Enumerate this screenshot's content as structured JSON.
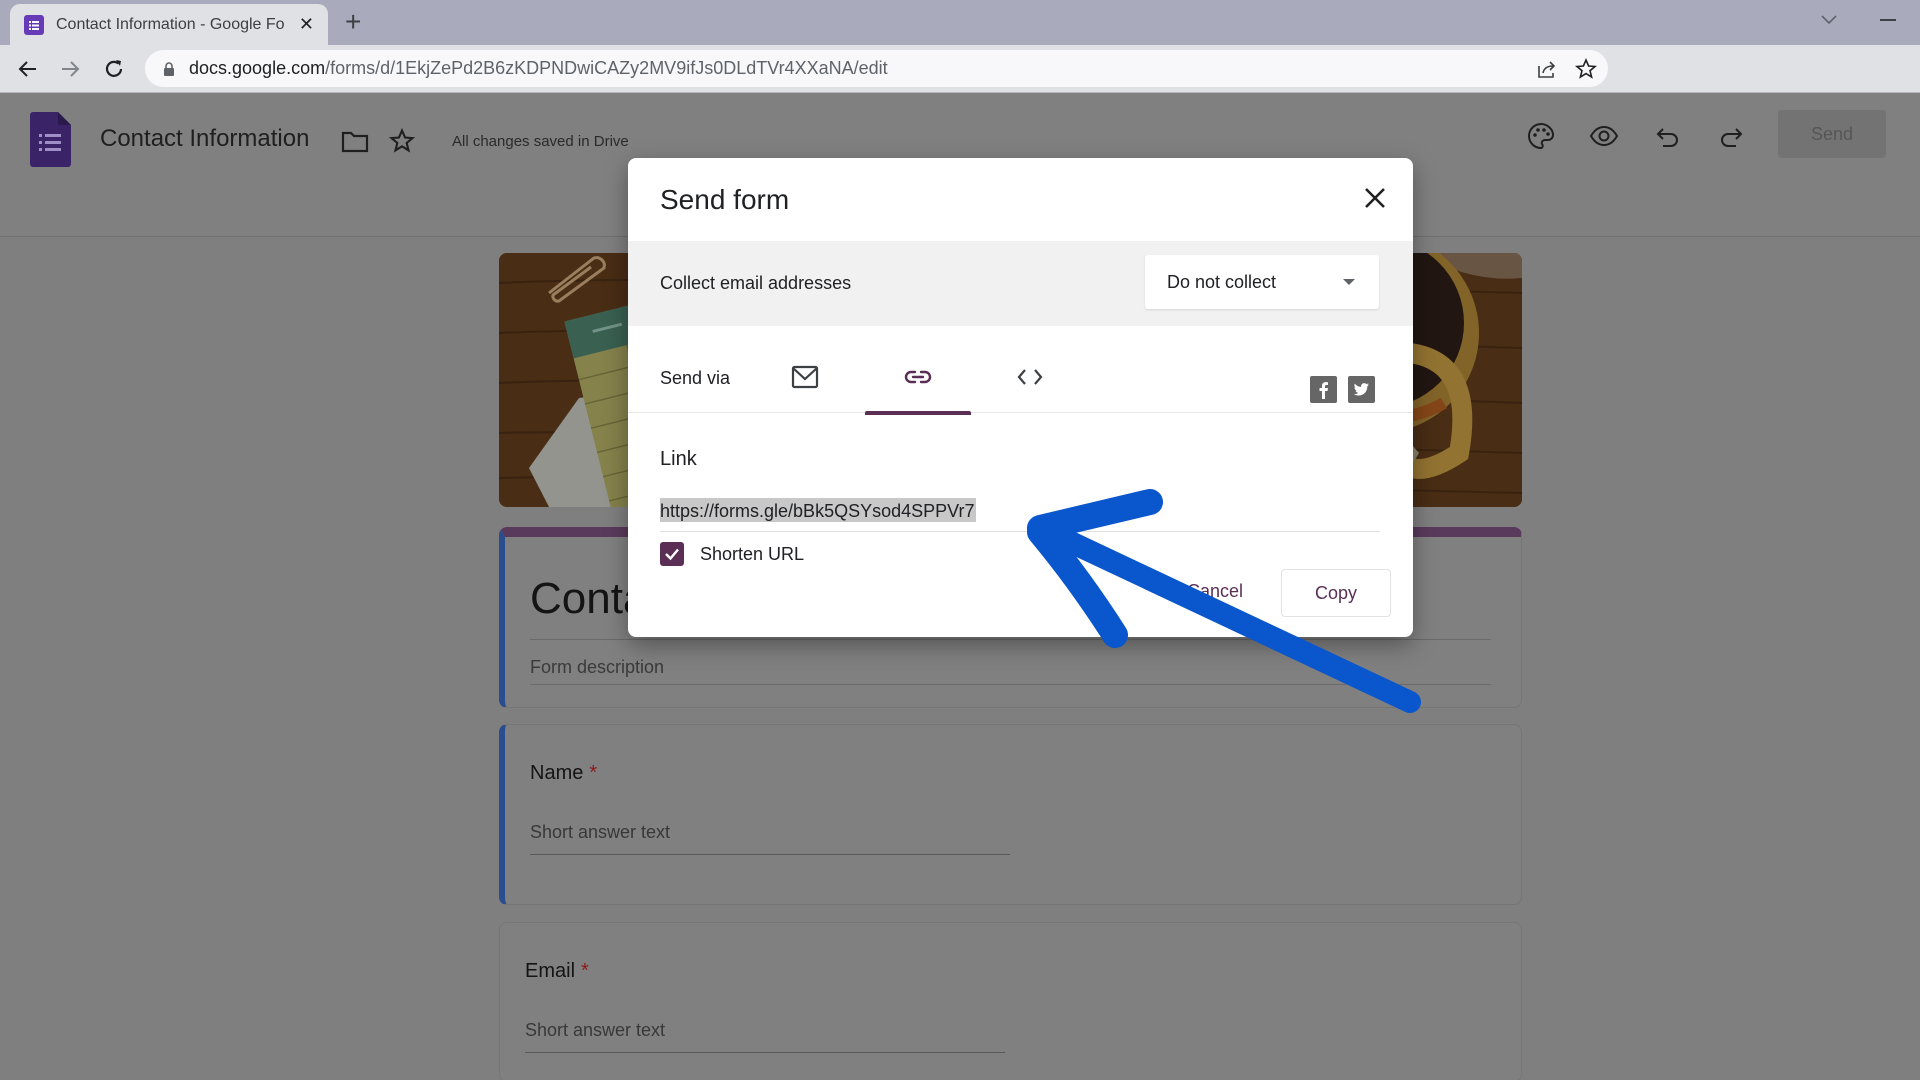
{
  "browser": {
    "tab_title": "Contact Information - Google Fo",
    "tab_close_icon": "close-icon",
    "new_tab_icon": "plus-icon",
    "url_host": "docs.google.com",
    "url_path": "/forms/d/1EkjZePd2B6zKDPNDwiCAZy2MV9ifJs0DLdTVr4XXaNA/edit"
  },
  "app": {
    "doc_title": "Contact Information",
    "save_status": "All changes saved in Drive",
    "send_label": "Send",
    "icons": [
      "palette-icon",
      "eye-preview-icon",
      "undo-icon",
      "redo-icon"
    ]
  },
  "form": {
    "title": "Contact Information",
    "title_visible": "Conta",
    "description_placeholder": "Form description",
    "questions": [
      {
        "label": "Name",
        "required": "*",
        "answer_placeholder": "Short answer text"
      },
      {
        "label": "Email",
        "required": "*",
        "answer_placeholder": "Short answer text"
      }
    ]
  },
  "dialog": {
    "title": "Send form",
    "collect_label": "Collect email addresses",
    "collect_value": "Do not collect",
    "send_via_label": "Send via",
    "send_via_tabs": [
      {
        "name": "email",
        "icon": "mail-icon",
        "active": false
      },
      {
        "name": "link",
        "icon": "link-icon",
        "active": true
      },
      {
        "name": "embed",
        "icon": "code-icon",
        "active": false
      }
    ],
    "social": [
      "facebook-icon",
      "twitter-icon"
    ],
    "link_label": "Link",
    "link_value": "https://forms.gle/bBk5QSYsod4SPPVr7",
    "shorten_label": "Shorten URL",
    "shorten_checked": true,
    "cancel_label": "Cancel",
    "copy_label": "Copy"
  },
  "colors": {
    "forms_purple": "#673ab7",
    "accent_plum": "#5b2e55",
    "annotation_blue": "#0a56cc",
    "overlay_grey": "#808080"
  }
}
